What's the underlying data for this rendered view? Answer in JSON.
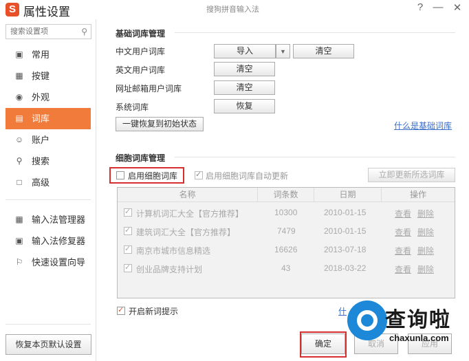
{
  "window": {
    "app_title": "属性设置",
    "subtitle": "搜狗拼音输入法",
    "logo_letter": "S",
    "help_label": "?",
    "minimize_label": "—",
    "close_label": "✕"
  },
  "sidebar": {
    "search_placeholder": "搜索设置项",
    "items": [
      {
        "label": "常用",
        "icon": "monitor-icon"
      },
      {
        "label": "按键",
        "icon": "keyboard-icon"
      },
      {
        "label": "外观",
        "icon": "shirt-icon"
      },
      {
        "label": "词库",
        "icon": "book-icon"
      },
      {
        "label": "账户",
        "icon": "user-icon"
      },
      {
        "label": "搜索",
        "icon": "search-icon"
      },
      {
        "label": "高级",
        "icon": "square-icon"
      }
    ],
    "tools": [
      {
        "label": "输入法管理器",
        "icon": "manager-icon"
      },
      {
        "label": "输入法修复器",
        "icon": "toolbox-icon"
      },
      {
        "label": "快速设置向导",
        "icon": "flag-icon"
      }
    ],
    "restore_defaults": "恢复本页默认设置",
    "active_color": "#f07b3a"
  },
  "basic": {
    "title": "基础词库管理",
    "rows": [
      {
        "label": "中文用户词库",
        "btn1": "导入",
        "btn2": "清空"
      },
      {
        "label": "英文用户词库",
        "btn": "清空"
      },
      {
        "label": "网址邮箱用户词库",
        "btn": "清空"
      },
      {
        "label": "系统词库",
        "btn": "恢复"
      }
    ],
    "restore_initial": "一键恢复到初始状态",
    "what_is_link": "什么是基础词库"
  },
  "cell": {
    "title": "细胞词库管理",
    "enable_label": "启用细胞词库",
    "auto_update_label": "启用细胞词库自动更新",
    "update_now": "立即更新所选词库",
    "columns": [
      "名称",
      "词条数",
      "日期",
      "操作"
    ],
    "rows": [
      {
        "name": "计算机词汇大全【官方推荐】",
        "count": "10300",
        "date": "2010-01-15",
        "view": "查看",
        "delete": "删除"
      },
      {
        "name": "建筑词汇大全【官方推荐】",
        "count": "7479",
        "date": "2010-01-15",
        "view": "查看",
        "delete": "删除"
      },
      {
        "name": "南京市城市信息精选",
        "count": "16626",
        "date": "2013-07-18",
        "view": "查看",
        "delete": "删除"
      },
      {
        "name": "创业品牌支持计划",
        "count": "43",
        "date": "2018-03-22",
        "view": "查看",
        "delete": "删除"
      }
    ],
    "new_word_hint": "开启新词提示",
    "partial_link": "什"
  },
  "footer": {
    "ok": "确定",
    "cancel": "取消",
    "apply": "应用"
  },
  "watermark": {
    "text": "查询啦",
    "url": "chaxunla.com"
  }
}
